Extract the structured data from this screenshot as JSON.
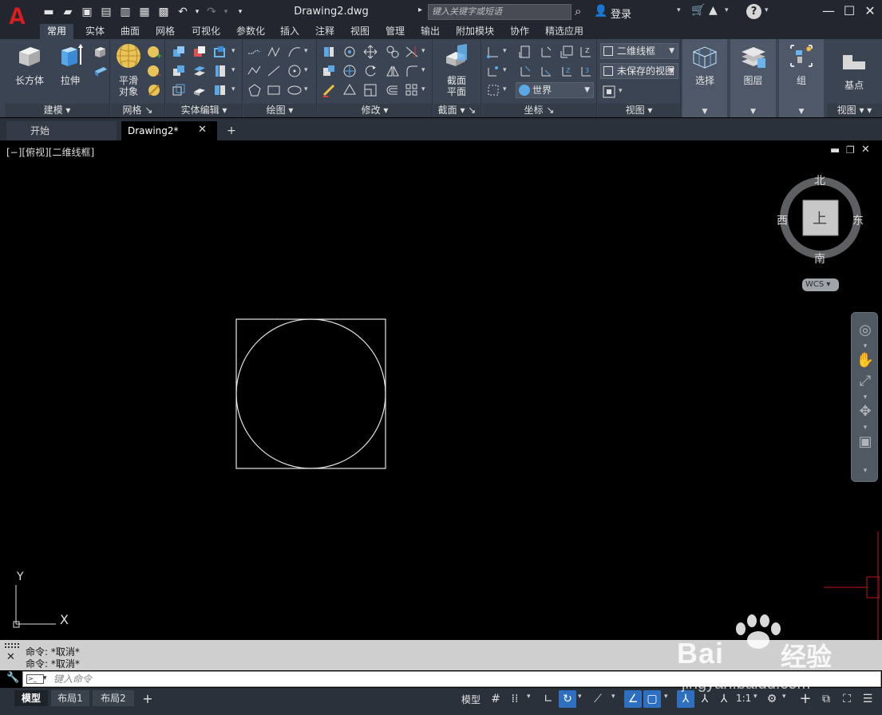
{
  "titlebar": {
    "app_logo": "A",
    "document_title": "Drawing2.dwg",
    "search_placeholder": "键入关键字或短语",
    "login_label": "登录"
  },
  "ribbon_tabs": [
    "常用",
    "实体",
    "曲面",
    "网格",
    "可视化",
    "参数化",
    "插入",
    "注释",
    "视图",
    "管理",
    "输出",
    "附加模块",
    "协作",
    "精选应用"
  ],
  "ribbon": {
    "modeling": {
      "title": "建模",
      "box_label": "长方体",
      "extrude_label": "拉伸"
    },
    "mesh": {
      "title": "网格",
      "smooth_label": "平滑\n对象"
    },
    "solid_edit": {
      "title": "实体编辑"
    },
    "draw": {
      "title": "绘图"
    },
    "modify": {
      "title": "修改"
    },
    "section": {
      "title": "截面",
      "section_plane_label": "截面\n平面"
    },
    "coordinates": {
      "title": "坐标",
      "ucs_value": "世界"
    },
    "view": {
      "title": "视图",
      "visual_style": "二维线框",
      "named_view": "未保存的视图"
    },
    "select": {
      "label": "选择"
    },
    "layers": {
      "label": "图层"
    },
    "group": {
      "label": "组"
    },
    "base": {
      "label": "基点",
      "title": "视图"
    }
  },
  "file_tabs": {
    "start": "开始",
    "drawing": "Drawing2*"
  },
  "viewport": {
    "label": "[−][俯视][二维线框]",
    "viewcube": {
      "north": "北",
      "south": "南",
      "east": "东",
      "west": "西",
      "face": "上"
    },
    "wcs": "WCS",
    "ucs_x": "X",
    "ucs_y": "Y"
  },
  "command": {
    "history": [
      "命令: *取消*",
      "命令: *取消*"
    ],
    "input_placeholder": "键入命令"
  },
  "status": {
    "layout_tabs": [
      "模型",
      "布局1",
      "布局2"
    ],
    "model_label": "模型",
    "scale": "1:1"
  },
  "watermark": {
    "text": "Bai",
    "cn": "经验",
    "url": "jingyan.baidu.com"
  },
  "colors": {
    "accent": "#2f6fbf",
    "ribbon": "#3b4452",
    "logo": "#d81e1e",
    "ucs_red": "#c0181a"
  }
}
